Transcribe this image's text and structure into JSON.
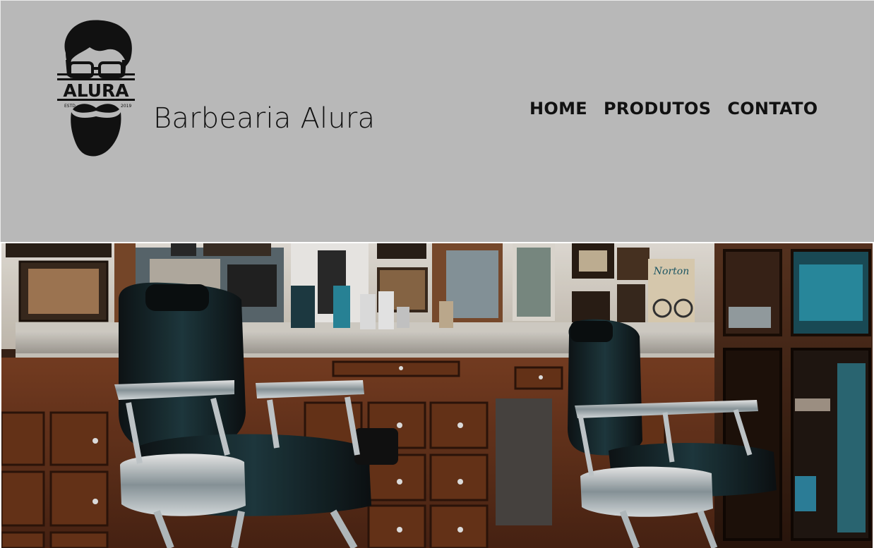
{
  "header": {
    "brand_name": "Barbearia Alura",
    "logo": {
      "icon": "bearded-man-logo-icon",
      "wordmark": "ALURA",
      "estd_label": "ESTD",
      "year": "2019"
    },
    "background_color": "#b8b8b8"
  },
  "nav": {
    "items": [
      {
        "label": "HOME"
      },
      {
        "label": "PRODUTOS"
      },
      {
        "label": "CONTATO"
      }
    ]
  },
  "hero": {
    "icon": "barbershop-interior-image"
  }
}
